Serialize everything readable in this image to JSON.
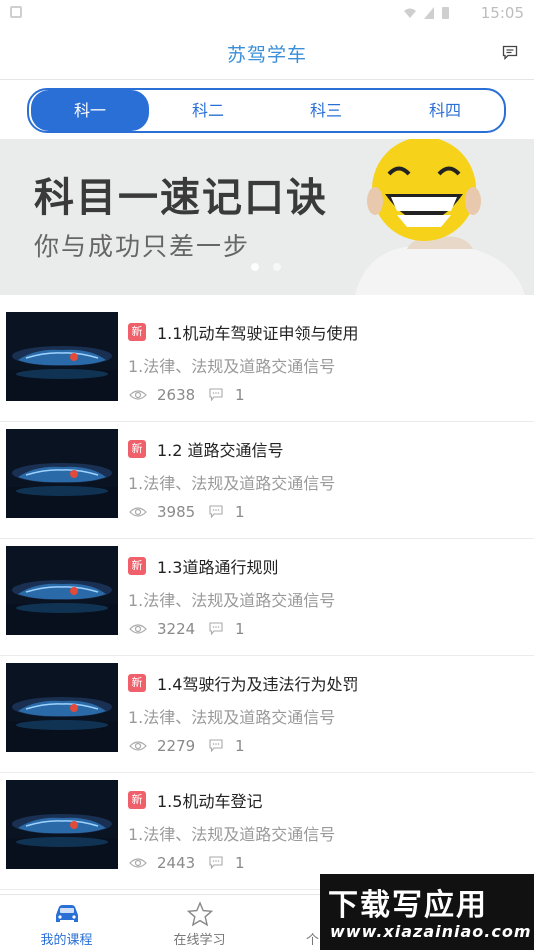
{
  "status_bar": {
    "time": "15:05"
  },
  "header": {
    "title": "苏驾学车",
    "message_icon": "message-icon"
  },
  "subject_tabs": [
    {
      "label": "科一",
      "active": true
    },
    {
      "label": "科二",
      "active": false
    },
    {
      "label": "科三",
      "active": false
    },
    {
      "label": "科四",
      "active": false
    }
  ],
  "banner": {
    "headline": "科目一速记口诀",
    "subline": "你与成功只差一步",
    "active_slide": 1,
    "slides": 2
  },
  "courses": [
    {
      "badge": "新",
      "title": "1.1机动车驾驶证申领与使用",
      "subtitle": "1.法律、法规及道路交通信号",
      "views": "2638",
      "comments": "1"
    },
    {
      "badge": "新",
      "title": "1.2 道路交通信号",
      "subtitle": "1.法律、法规及道路交通信号",
      "views": "3985",
      "comments": "1"
    },
    {
      "badge": "新",
      "title": "1.3道路通行规则",
      "subtitle": "1.法律、法规及道路交通信号",
      "views": "3224",
      "comments": "1"
    },
    {
      "badge": "新",
      "title": "1.4驾驶行为及违法行为处罚",
      "subtitle": "1.法律、法规及道路交通信号",
      "views": "2279",
      "comments": "1"
    },
    {
      "badge": "新",
      "title": "1.5机动车登记",
      "subtitle": "1.法律、法规及道路交通信号",
      "views": "2443",
      "comments": "1"
    }
  ],
  "tab_bar": [
    {
      "label": "我的课程",
      "icon": "car-icon",
      "active": true
    },
    {
      "label": "在线学习",
      "icon": "star-icon",
      "active": false
    },
    {
      "label": "个",
      "icon": "user-icon",
      "active": false
    }
  ],
  "watermark": {
    "line1": "下载写应用",
    "line2": "www.xiazainiao.com"
  },
  "colors": {
    "accent": "#2a6fd6",
    "title": "#3a8fd8",
    "badge": "#f0606b"
  }
}
